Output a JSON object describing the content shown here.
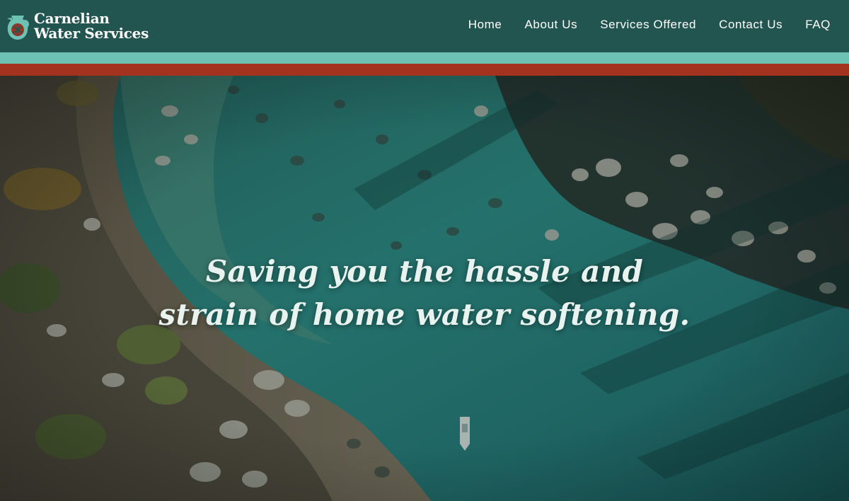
{
  "brand": {
    "line1": "Carnelian",
    "line2": "Water Services",
    "logo_icon": "pitcher-logo-icon"
  },
  "nav": {
    "items": [
      {
        "label": "Home"
      },
      {
        "label": "About Us"
      },
      {
        "label": "Services Offered"
      },
      {
        "label": "Contact Us"
      },
      {
        "label": "FAQ"
      }
    ]
  },
  "hero": {
    "line1": "Saving you the hassle and",
    "line2": "strain of home water softening."
  },
  "colors": {
    "header": "#235550",
    "stripe_teal": "#6ec2b4",
    "stripe_red": "#a3321f",
    "water": "#2c8c87",
    "text": "#ffffff"
  }
}
